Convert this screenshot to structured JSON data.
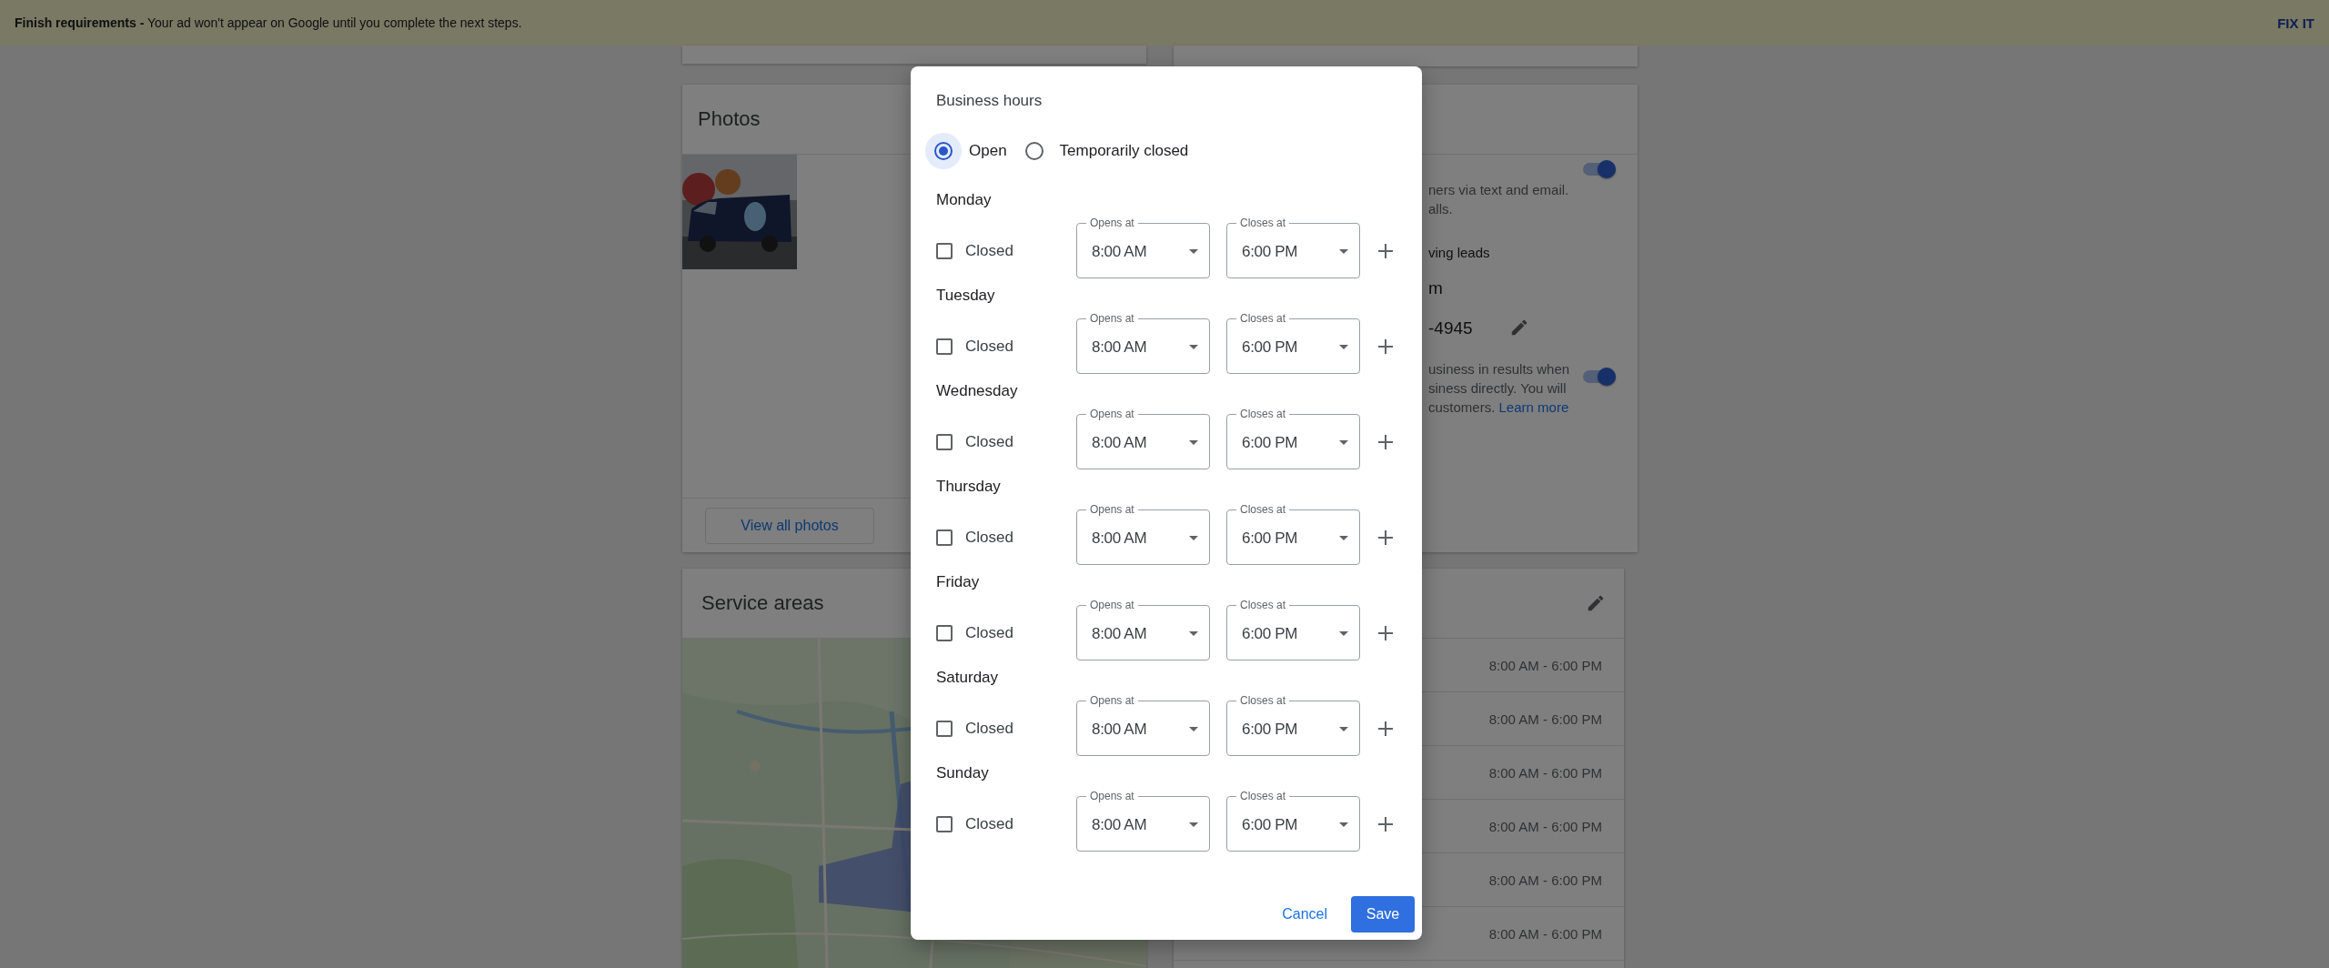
{
  "banner": {
    "title": "Finish requirements -",
    "message": "Your ad won't appear on Google until you complete the next steps.",
    "action": "FIX IT"
  },
  "photos_card": {
    "title": "Photos",
    "button": "View all photos"
  },
  "service_areas_card": {
    "title": "Service areas"
  },
  "leads_card": {
    "toggles": [
      {
        "on": true
      },
      {
        "on": true
      }
    ],
    "description_1": [
      "ners via text and email.",
      "alls."
    ],
    "subheading": "ving leads",
    "email_fragment": "m",
    "phone": "-4945",
    "description_2": [
      "usiness in results when",
      "siness directly. You will",
      "customers."
    ],
    "link": "Learn more"
  },
  "hours_card": {
    "rows": [
      "8:00 AM - 6:00 PM",
      "8:00 AM - 6:00 PM",
      "8:00 AM - 6:00 PM",
      "8:00 AM - 6:00 PM",
      "8:00 AM - 6:00 PM",
      "8:00 AM - 6:00 PM"
    ]
  },
  "dialog": {
    "title": "Business hours",
    "status_options": [
      {
        "label": "Open",
        "selected": true
      },
      {
        "label": "Temporarily closed",
        "selected": false
      }
    ],
    "days": [
      {
        "day": "Monday",
        "closed_label": "Closed",
        "closed": false,
        "opens_label": "Opens at",
        "opens": "8:00 AM",
        "closes_label": "Closes at",
        "closes": "6:00 PM"
      },
      {
        "day": "Tuesday",
        "closed_label": "Closed",
        "closed": false,
        "opens_label": "Opens at",
        "opens": "8:00 AM",
        "closes_label": "Closes at",
        "closes": "6:00 PM"
      },
      {
        "day": "Wednesday",
        "closed_label": "Closed",
        "closed": false,
        "opens_label": "Opens at",
        "opens": "8:00 AM",
        "closes_label": "Closes at",
        "closes": "6:00 PM"
      },
      {
        "day": "Thursday",
        "closed_label": "Closed",
        "closed": false,
        "opens_label": "Opens at",
        "opens": "8:00 AM",
        "closes_label": "Closes at",
        "closes": "6:00 PM"
      },
      {
        "day": "Friday",
        "closed_label": "Closed",
        "closed": false,
        "opens_label": "Opens at",
        "opens": "8:00 AM",
        "closes_label": "Closes at",
        "closes": "6:00 PM"
      },
      {
        "day": "Saturday",
        "closed_label": "Closed",
        "closed": false,
        "opens_label": "Opens at",
        "opens": "8:00 AM",
        "closes_label": "Closes at",
        "closes": "6:00 PM"
      },
      {
        "day": "Sunday",
        "closed_label": "Closed",
        "closed": false,
        "opens_label": "Opens at",
        "opens": "8:00 AM",
        "closes_label": "Closes at",
        "closes": "6:00 PM"
      }
    ],
    "cancel": "Cancel",
    "save": "Save"
  }
}
